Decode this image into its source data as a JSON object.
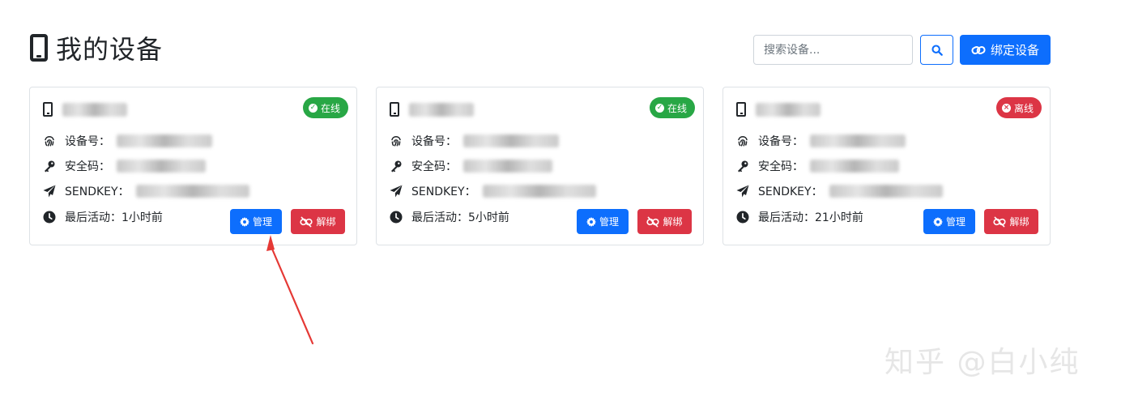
{
  "header": {
    "title": "我的设备",
    "title_icon": "mobile-phone-icon",
    "search_placeholder": "搜索设备...",
    "search_icon": "search-icon",
    "bind_label": "绑定设备",
    "bind_icon": "link-icon",
    "accent_color": "#0d6efd"
  },
  "devices": [
    {
      "name": "",
      "status": "在线",
      "status_type": "online",
      "device_id_label": "设备号：",
      "security_code_label": "安全码：",
      "sendkey_label": "SENDKEY：",
      "last_active_label": "最后活动：",
      "last_active": "1小时前",
      "manage_label": "管理",
      "unbind_label": "解绑"
    },
    {
      "name": "",
      "status": "在线",
      "status_type": "online",
      "device_id_label": "设备号：",
      "security_code_label": "安全码：",
      "sendkey_label": "SENDKEY：",
      "last_active_label": "最后活动：",
      "last_active": "5小时前",
      "manage_label": "管理",
      "unbind_label": "解绑"
    },
    {
      "name": "",
      "status": "离线",
      "status_type": "offline",
      "device_id_label": "设备号：",
      "security_code_label": "安全码：",
      "sendkey_label": "SENDKEY：",
      "last_active_label": "最后活动：",
      "last_active": "21小时前",
      "manage_label": "管理",
      "unbind_label": "解绑"
    }
  ],
  "colors": {
    "online": "#28a745",
    "offline": "#dc3545",
    "primary": "#0d6efd",
    "danger": "#dc3545"
  },
  "watermark": "知乎 @白小纯"
}
